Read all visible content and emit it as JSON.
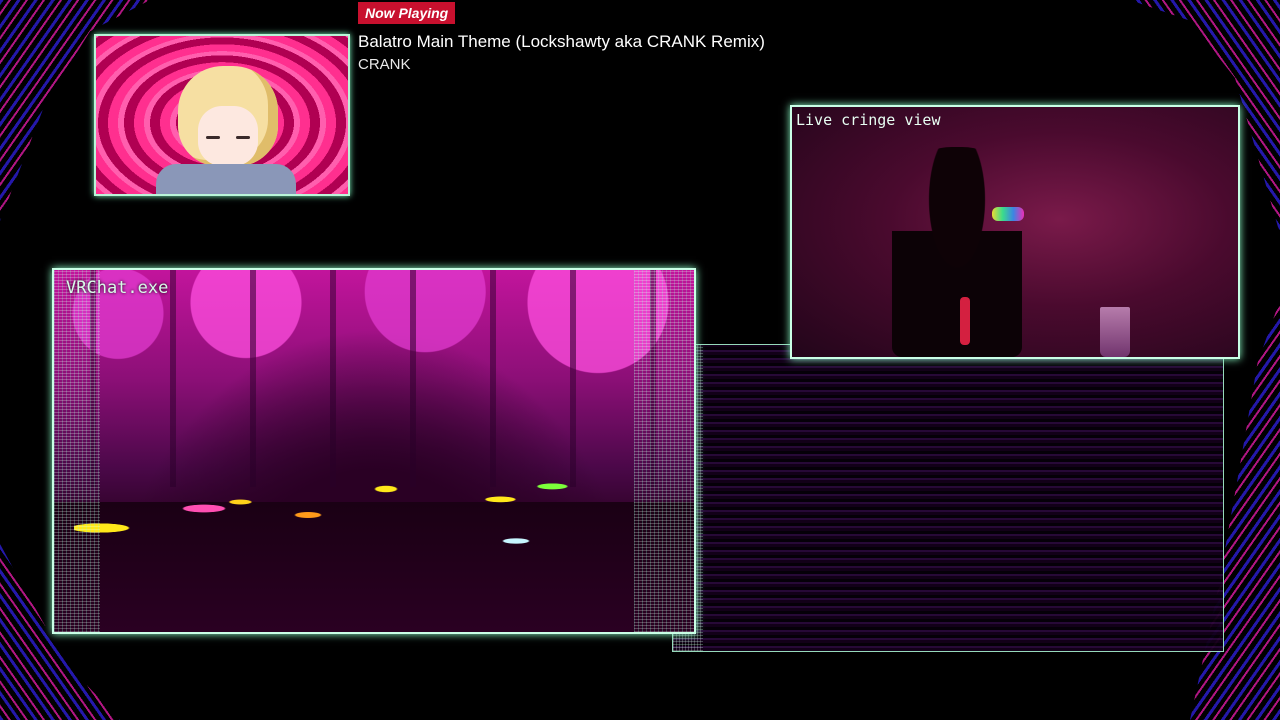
{
  "now_playing": {
    "badge": "Now Playing",
    "title": "Balatro Main Theme (Lockshawty aka CRANK Remix)",
    "artist": "CRANK"
  },
  "vrchat_window": {
    "label": "VRChat.exe"
  },
  "webcam_window": {
    "label": "Live cringe view"
  },
  "colors": {
    "frame_border": "#c9ffe6",
    "badge_bg": "#c8102e",
    "accent_magenta": "#c2149c",
    "accent_blue": "#2a1cc8"
  }
}
